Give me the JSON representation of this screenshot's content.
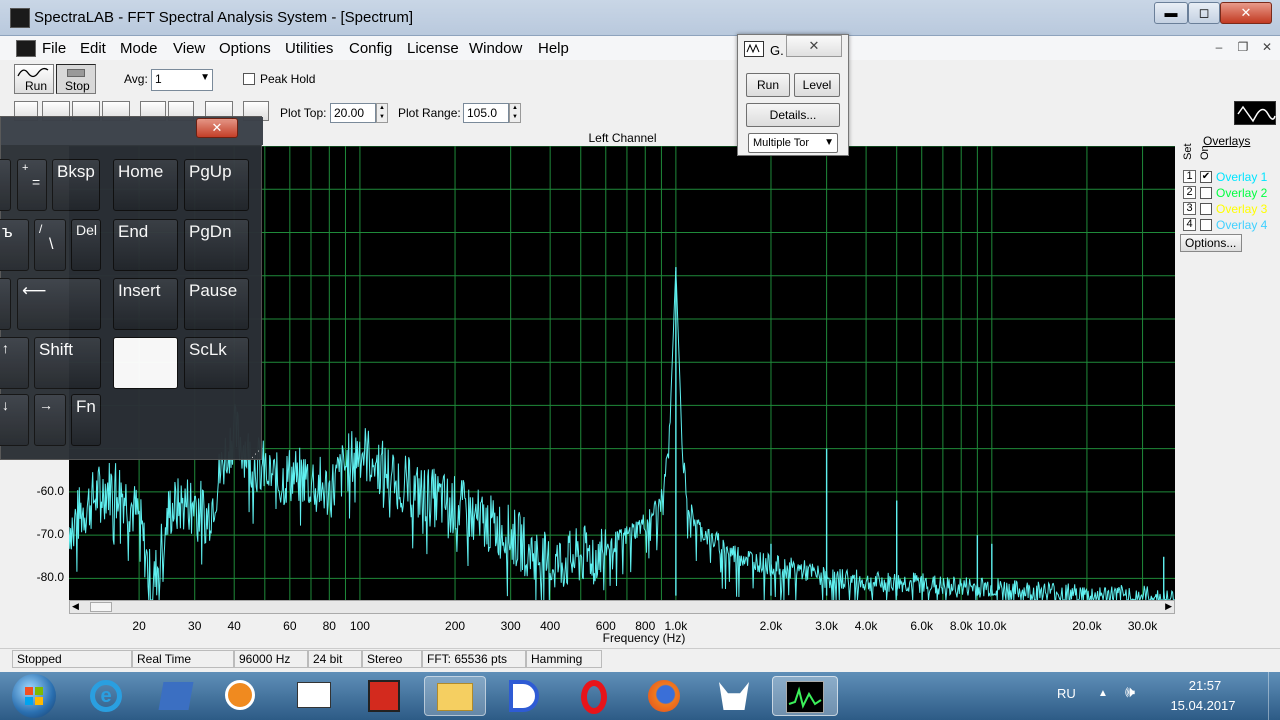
{
  "window": {
    "title": "SpectraLAB - FFT Spectral Analysis System - [Spectrum]",
    "min_label": "▬",
    "max_label": "◻",
    "close_label": "✕"
  },
  "menu": [
    "File",
    "Edit",
    "Mode",
    "View",
    "Options",
    "Utilities",
    "Config",
    "License",
    "Window",
    "Help"
  ],
  "mdi_controls": [
    "–",
    "❐",
    "✕"
  ],
  "toolbar": {
    "run_label": "Run",
    "stop_label": "Stop",
    "avg_label": "Avg:",
    "avg_value": "1",
    "peak_hold_label": "Peak Hold",
    "plot_top_label": "Plot Top:",
    "plot_top_value": "20.00",
    "plot_range_label": "Plot Range:",
    "plot_range_value": "105.0"
  },
  "plot": {
    "channel_label": "Left Channel",
    "x_axis_label": "Frequency (Hz)"
  },
  "overlays": {
    "header": "Overlays",
    "set_label": "Set",
    "on_label": "On",
    "items": [
      {
        "num": "1",
        "label": "Overlay 1",
        "checked": true,
        "color": "#00e5ff"
      },
      {
        "num": "2",
        "label": "Overlay 2",
        "checked": false,
        "color": "#00ff40"
      },
      {
        "num": "3",
        "label": "Overlay 3",
        "checked": false,
        "color": "#ffff00"
      },
      {
        "num": "4",
        "label": "Overlay 4",
        "checked": false,
        "color": "#40d0ff"
      }
    ],
    "options_label": "Options..."
  },
  "status": [
    "Stopped",
    "Real Time",
    "96000 Hz",
    "24 bit",
    "Stereo",
    "FFT: 65536 pts",
    "Hamming"
  ],
  "taskbar": {
    "lang": "RU",
    "time": "21:57",
    "date": "15.04.2017",
    "tray_up": "▲",
    "speaker": "🕪"
  },
  "osk": {
    "close_label": "✕",
    "keys": {
      "plus_top": "+",
      "plus_bottom": "=",
      "bksp": "Bksp",
      "home": "Home",
      "pgup": "PgUp",
      "hard_sign": "ъ",
      "slash_top": "/",
      "slash_bottom": "\\",
      "del": "Del",
      "end": "End",
      "pgdn": "PgDn",
      "enter": "⟵",
      "insert": "Insert",
      "pause": "Pause",
      "up": "↑",
      "shift": "Shift",
      "sclk": "ScLk",
      "down": "↓",
      "right": "→",
      "fn": "Fn"
    }
  },
  "generator": {
    "title": "G.",
    "close_label": "✕",
    "run_label": "Run",
    "level_label": "Level",
    "details_label": "Details...",
    "mode_value": "Multiple Tor"
  },
  "chart_data": {
    "type": "line",
    "title": "Left Channel",
    "xlabel": "Frequency (Hz)",
    "ylabel": "",
    "x_scale": "log",
    "xlim": [
      12,
      38000
    ],
    "x_ticks": [
      20,
      30,
      40,
      60,
      80,
      100,
      200,
      300,
      400,
      600,
      800,
      1000,
      2000,
      3000,
      4000,
      6000,
      8000,
      10000,
      20000,
      30000
    ],
    "x_tick_labels": [
      "20",
      "30",
      "40",
      "60",
      "80",
      "100",
      "200",
      "300",
      "400",
      "600",
      "800",
      "1.0k",
      "2.0k",
      "3.0k",
      "4.0k",
      "6.0k",
      "8.0k",
      "10.0k",
      "20.0k",
      "30.0k"
    ],
    "ylim": [
      -85,
      20
    ],
    "y_ticks": [
      -60,
      -70,
      -80
    ],
    "y_tick_labels": [
      "-60.0",
      "-70.0",
      "-80.0"
    ],
    "grid": true,
    "colors": {
      "background": "#000000",
      "grid": "#1f8a3a",
      "trace": "#5ff0f0"
    },
    "series": [
      {
        "x": [
          12,
          15,
          17,
          20,
          22,
          25,
          30,
          33,
          38,
          40,
          45,
          50,
          55,
          60,
          70,
          80,
          90,
          100,
          120,
          150,
          200,
          250,
          300,
          400,
          500,
          600,
          700,
          800,
          900,
          950,
          1000,
          1050,
          1100,
          1200,
          1500,
          2000,
          2500,
          3000,
          3500,
          4000,
          5000,
          6000,
          7000,
          8000,
          9000,
          10000,
          12000,
          15000,
          20000,
          25000,
          30000,
          35000,
          38000
        ],
        "y": [
          -68,
          -60,
          -58,
          -66,
          -83,
          -64,
          -62,
          -66,
          -50,
          -46,
          -52,
          -55,
          -58,
          -56,
          -57,
          -60,
          -54,
          -50,
          -55,
          -60,
          -63,
          -67,
          -70,
          -77,
          -75,
          -73,
          -70,
          -67,
          -62,
          -50,
          -8,
          -52,
          -64,
          -69,
          -74,
          -77,
          -78,
          -80,
          -80,
          -81,
          -81,
          -81,
          -82,
          -82,
          -82,
          -82,
          -83,
          -83,
          -84,
          -84,
          -84,
          -85,
          -85
        ]
      },
      {
        "x": [
          1000,
          2000,
          3000,
          5000,
          9000,
          10000,
          35000
        ],
        "y": [
          -8,
          -72,
          -50,
          -62,
          -70,
          -72,
          -75
        ]
      }
    ]
  }
}
